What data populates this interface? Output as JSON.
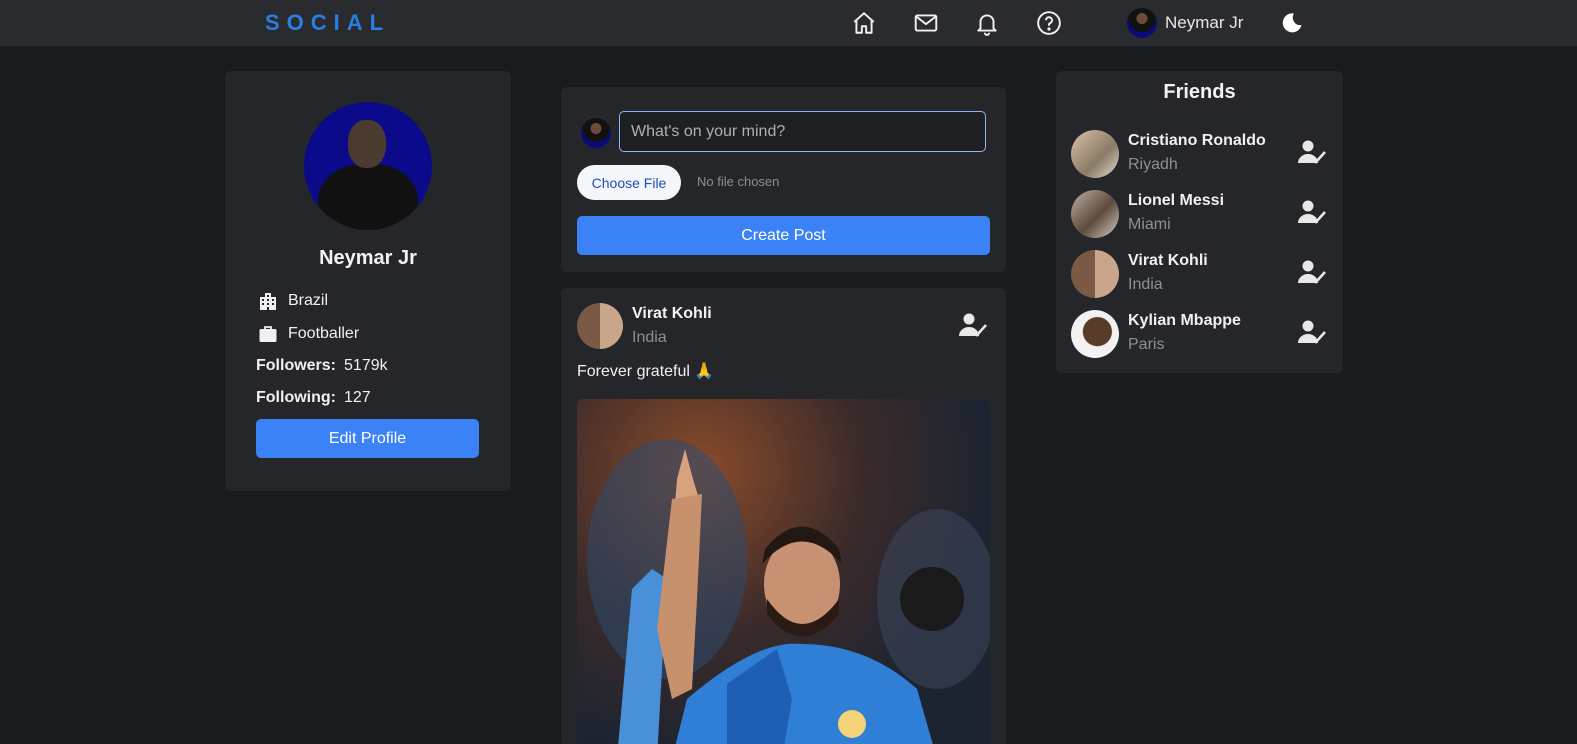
{
  "brand": "SOCIAL",
  "nav": {
    "icons": [
      "home-icon",
      "mail-icon",
      "bell-icon",
      "help-icon"
    ],
    "user_name": "Neymar Jr",
    "theme_icon": "moon-icon"
  },
  "profile": {
    "name": "Neymar Jr",
    "location": "Brazil",
    "occupation": "Footballer",
    "followers_label": "Followers:",
    "followers": "5179k",
    "following_label": "Following:",
    "following": "127",
    "edit_label": "Edit Profile"
  },
  "composer": {
    "placeholder": "What's on your mind?",
    "file_button": "Choose File",
    "file_status": "No file chosen",
    "create_label": "Create Post"
  },
  "post": {
    "author": "Virat Kohli",
    "location": "India",
    "text": "Forever grateful 🙏"
  },
  "friends": {
    "title": "Friends",
    "items": [
      {
        "name": "Cristiano Ronaldo",
        "location": "Riyadh"
      },
      {
        "name": "Lionel Messi",
        "location": "Miami"
      },
      {
        "name": "Virat Kohli",
        "location": "India"
      },
      {
        "name": "Kylian Mbappe",
        "location": "Paris"
      }
    ]
  },
  "colors": {
    "accent": "#3b82f6",
    "brand": "#2a7de1",
    "background": "#1a1b1e",
    "card": "#252629"
  }
}
